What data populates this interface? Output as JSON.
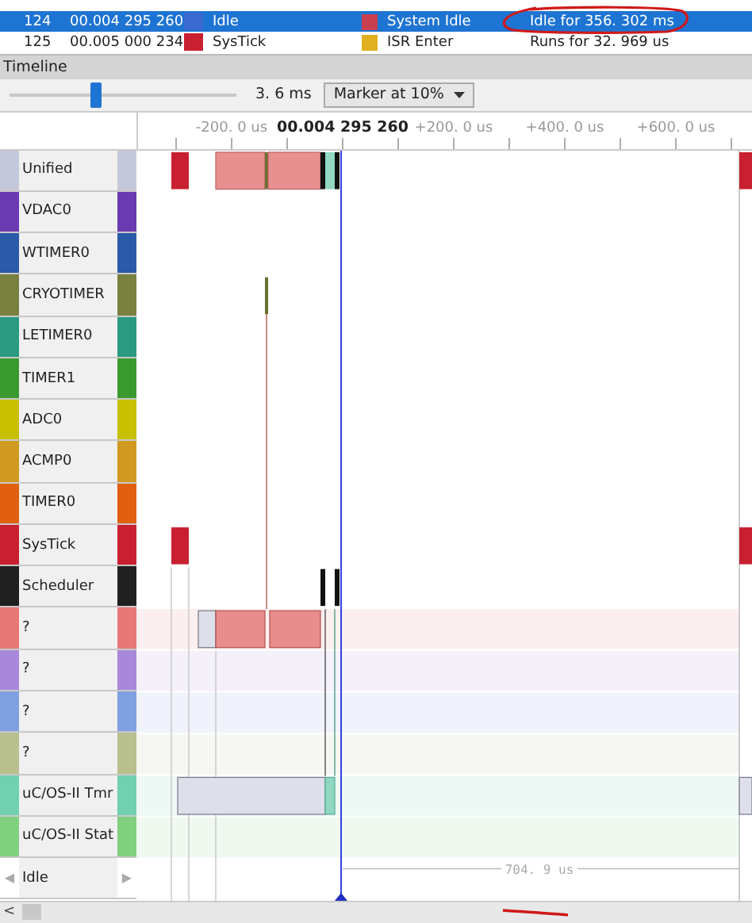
{
  "table": {
    "rows": [
      {
        "index": "124",
        "time": "00.004 295 260",
        "context": "Idle",
        "color": "#3a6ad0",
        "event": "System Idle",
        "detail": "Idle for 356. 302 ms",
        "selected": true
      },
      {
        "index": "125",
        "time": "00.005 000 234",
        "context": "SysTick",
        "color": "#c82030",
        "event": "ISR Enter",
        "detail": "Runs for 32. 969 us",
        "selected": false
      }
    ]
  },
  "timeline": {
    "title": "Timeline",
    "zoom": {
      "level": 0.38,
      "reading": "3. 6 ms"
    },
    "marker_mode": "Marker at 10%",
    "ruler": [
      {
        "label": "-200. 0 us",
        "kind": "offset"
      },
      {
        "label": "00.004 295 260",
        "kind": "cursor"
      },
      {
        "label": "+200. 0 us",
        "kind": "offset"
      },
      {
        "label": "+400. 0 us",
        "kind": "offset"
      },
      {
        "label": "+600. 0 us",
        "kind": "offset"
      }
    ],
    "lanes": [
      {
        "name": "Unified",
        "kind": "isr",
        "color": "#c4c8d8"
      },
      {
        "name": "VDAC0",
        "kind": "isr",
        "color": "#6a3ab0"
      },
      {
        "name": "WTIMER0",
        "kind": "isr",
        "color": "#2a5aa8"
      },
      {
        "name": "CRYOTIMER",
        "kind": "isr",
        "color": "#7a8040"
      },
      {
        "name": "LETIMER0",
        "kind": "isr",
        "color": "#2a9a80"
      },
      {
        "name": "TIMER1",
        "kind": "isr",
        "color": "#3a9a30"
      },
      {
        "name": "ADC0",
        "kind": "isr",
        "color": "#c8c000"
      },
      {
        "name": "ACMP0",
        "kind": "isr",
        "color": "#d09a20"
      },
      {
        "name": "TIMER0",
        "kind": "isr",
        "color": "#e06010"
      },
      {
        "name": "SysTick",
        "kind": "isr",
        "color": "#c82030"
      },
      {
        "name": "Scheduler",
        "kind": "isr",
        "color": "#202020"
      },
      {
        "name": "?",
        "kind": "task",
        "color": "#e87878"
      },
      {
        "name": "?",
        "kind": "task",
        "color": "#a888d8"
      },
      {
        "name": "?",
        "kind": "task",
        "color": "#80a0e0"
      },
      {
        "name": "?",
        "kind": "task",
        "color": "#b8c090"
      },
      {
        "name": "uC/OS-II Tmr",
        "kind": "task",
        "color": "#70d0b0"
      },
      {
        "name": "uC/OS-II Stat",
        "kind": "task",
        "color": "#80d080"
      },
      {
        "name": "Idle",
        "kind": "idle",
        "nav_left": "◀",
        "nav_right": "▶"
      }
    ],
    "idle_duration": "704. 9 us",
    "scroll_left": "<"
  }
}
